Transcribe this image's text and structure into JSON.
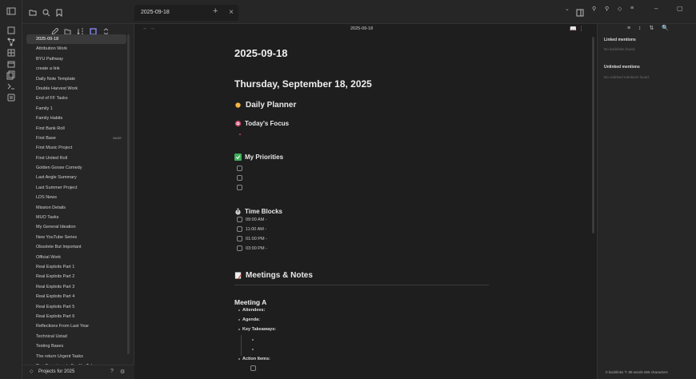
{
  "tab": {
    "title": "2025-09-18",
    "close": "×",
    "add": "+"
  },
  "explorer": {
    "files": [
      {
        "name": "2025-09-18",
        "active": true
      },
      {
        "name": "Attribution Work"
      },
      {
        "name": "BYU Pathway"
      },
      {
        "name": "create a link"
      },
      {
        "name": "Daily Note Template"
      },
      {
        "name": "Double Harvest Work"
      },
      {
        "name": "End of FF Tasks"
      },
      {
        "name": "Family 1"
      },
      {
        "name": "Family Habits"
      },
      {
        "name": "First Bank Roll"
      },
      {
        "name": "First Base",
        "badge": "BASE"
      },
      {
        "name": "First Music Project"
      },
      {
        "name": "First United Roll"
      },
      {
        "name": "Golden Goose Comedy"
      },
      {
        "name": "Last Angle Summary"
      },
      {
        "name": "Last Summer Project"
      },
      {
        "name": "LDS News"
      },
      {
        "name": "Mission Details"
      },
      {
        "name": "MUO Tasks"
      },
      {
        "name": "My General Ideation"
      },
      {
        "name": "New YouTube Series"
      },
      {
        "name": "Obsolete But Important"
      },
      {
        "name": "Official Work"
      },
      {
        "name": "Real Exploits Part 1"
      },
      {
        "name": "Real Exploits Part 2"
      },
      {
        "name": "Real Exploits Part 3"
      },
      {
        "name": "Real Exploits Part 4"
      },
      {
        "name": "Real Exploits Part 5"
      },
      {
        "name": "Real Exploits Part 6"
      },
      {
        "name": "Reflections From Last Year"
      },
      {
        "name": "Technical Ustad"
      },
      {
        "name": "Testing Bases"
      },
      {
        "name": "The return Urgent Tasks"
      },
      {
        "name": "Tiny Experiments For YouTube"
      }
    ],
    "vault": "Projects for 2025",
    "vault_chevron": "◇"
  },
  "editor": {
    "header_title": "2025-09-18",
    "nav": "←  →",
    "actions": "📖  ⋮",
    "file_title": "2025-09-18",
    "date_heading": "Thursday, September 18, 2025",
    "daily_planner": "Daily Planner",
    "todays_focus": "Today's Focus",
    "my_priorities": "My Priorities",
    "time_blocks": "Time Blocks",
    "times": [
      "09:00 AM -",
      "11:00 AM -",
      "01:00 PM -",
      "03:00 PM -"
    ],
    "meetings_notes": "Meetings & Notes",
    "meeting_a": "Meeting A",
    "attendees": "Attendees:",
    "agenda": "Agenda:",
    "key_takeaways": "Key Takeaways:",
    "action_items": "Action Items:"
  },
  "right": {
    "tools": "≡ ↕ ⇅ 🔍",
    "linked": "Linked mentions",
    "linked_empty": "No backlinks found.",
    "unlinked": "Unlinked mentions",
    "unlinked_empty": "No unlinked mentions found."
  },
  "status": {
    "text": "0 backlinks  ✎  88 words  565 characters"
  }
}
